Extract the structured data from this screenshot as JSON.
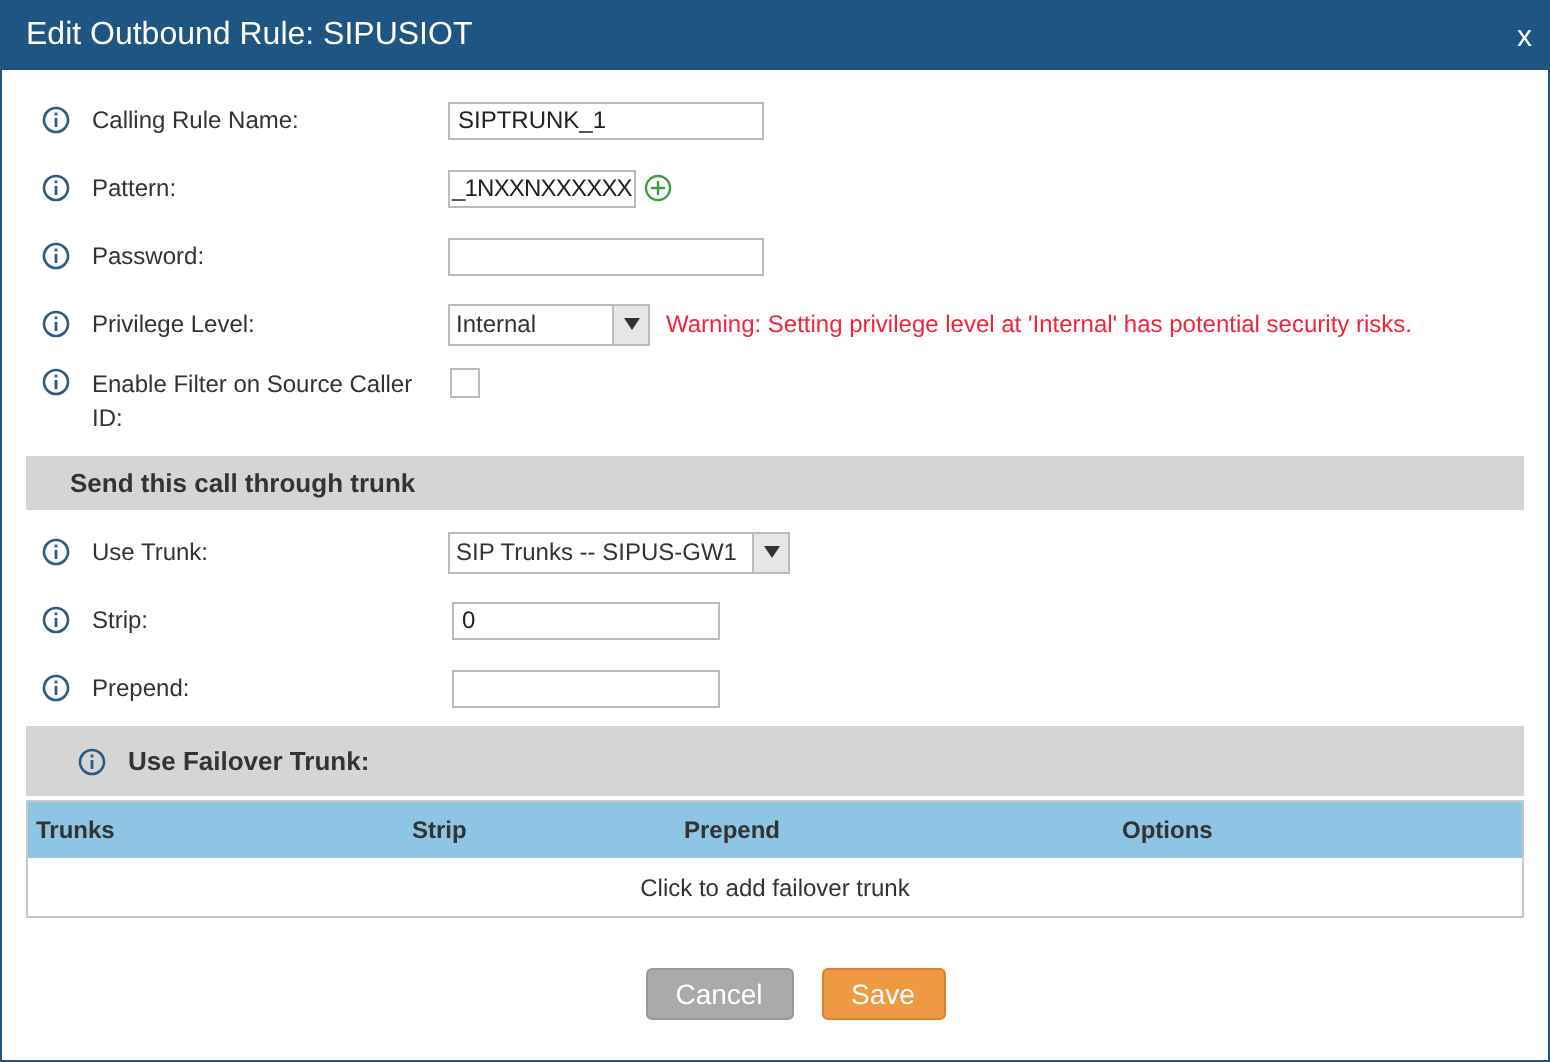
{
  "window": {
    "title": "Edit Outbound Rule: SIPUSIOT",
    "close": "x"
  },
  "fields": [
    {
      "kind": "text",
      "label": "Calling Rule Name:",
      "value": "SIPTRUNK_1"
    },
    {
      "kind": "pattern",
      "label": "Pattern:",
      "value": "_1NXXNXXXXXX"
    },
    {
      "kind": "text",
      "label": "Password:"
    },
    {
      "kind": "select",
      "label": "Privilege Level:",
      "value": "Internal",
      "warning": "Warning: Setting privilege level at 'Internal' has potential security risks."
    },
    {
      "kind": "checkbox",
      "label": "Enable Filter on Source Caller ID:",
      "checked": false
    }
  ],
  "trunk_section": {
    "title": "Send this call through trunk"
  },
  "trunk_fields": [
    {
      "kind": "select",
      "label": "Use Trunk:",
      "value": "SIP Trunks -- SIPUS-GW1"
    },
    {
      "kind": "text",
      "label": "Strip:",
      "value": "0"
    },
    {
      "kind": "text",
      "label": "Prepend:"
    }
  ],
  "failover": {
    "title": "Use Failover Trunk:"
  },
  "table": {
    "columns": [
      "Trunks",
      "Strip",
      "Prepend",
      "Options"
    ],
    "empty_row": "Click to add failover trunk"
  },
  "buttons": [
    {
      "label": "Cancel",
      "kind": "secondary"
    },
    {
      "label": "Save",
      "kind": "primary"
    }
  ]
}
